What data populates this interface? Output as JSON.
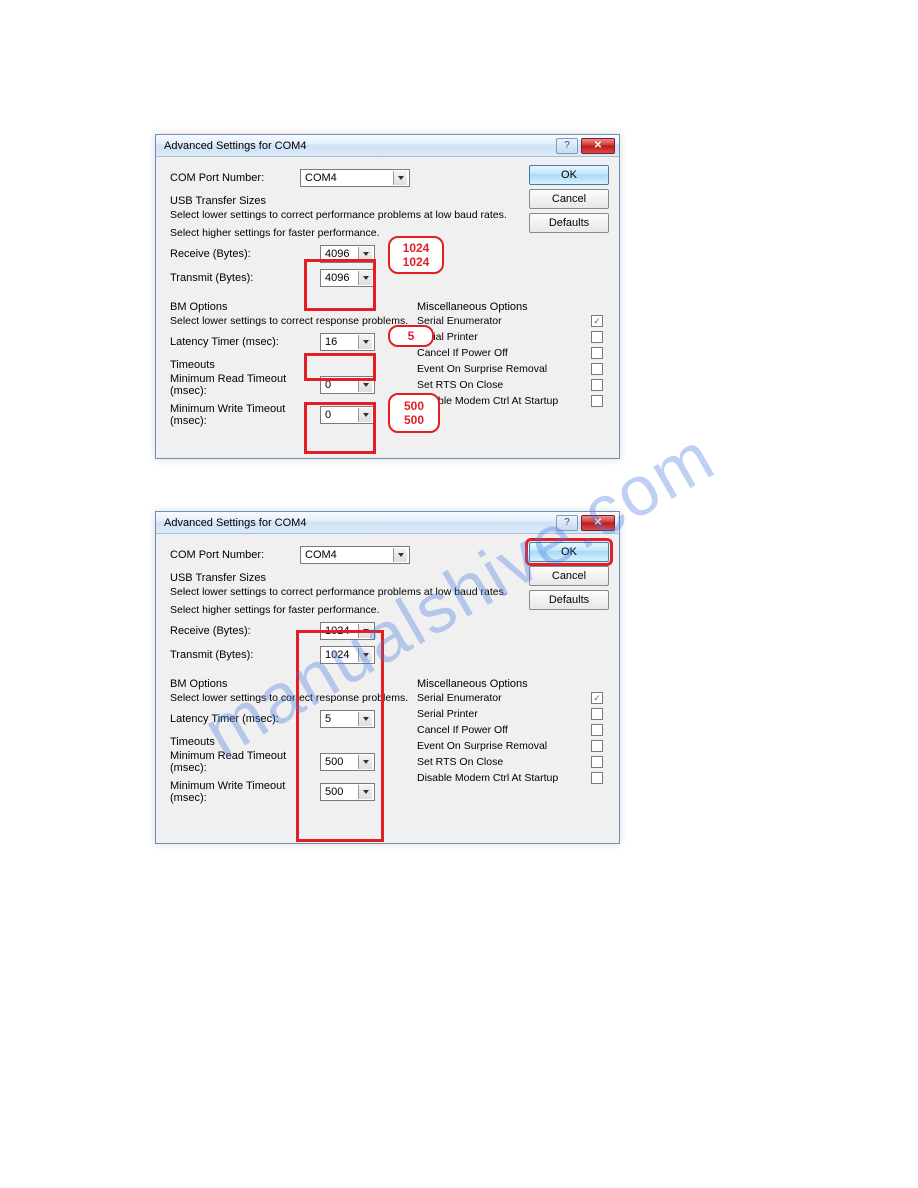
{
  "watermark": "manualshive.com",
  "dialog1": {
    "title": "Advanced Settings for COM4",
    "comport_label": "COM Port Number:",
    "comport_value": "COM4",
    "buttons": {
      "ok": "OK",
      "cancel": "Cancel",
      "defaults": "Defaults"
    },
    "usb_group": "USB Transfer Sizes",
    "usb_help1": "Select lower settings to correct performance problems at low baud rates.",
    "usb_help2": "Select higher settings for faster performance.",
    "receive_label": "Receive (Bytes):",
    "receive_value": "4096",
    "transmit_label": "Transmit (Bytes):",
    "transmit_value": "4096",
    "bm_group": "BM Options",
    "bm_help": "Select lower settings to correct response problems.",
    "latency_label": "Latency Timer (msec):",
    "latency_value": "16",
    "timeouts_group": "Timeouts",
    "min_read_label": "Minimum Read Timeout (msec):",
    "min_read_value": "0",
    "min_write_label": "Minimum Write Timeout (msec):",
    "min_write_value": "0",
    "misc_group": "Miscellaneous Options",
    "misc": {
      "serial_enum": "Serial Enumerator",
      "serial_printer": "Serial Printer",
      "cancel_poweroff": "Cancel If Power Off",
      "event_surprise": "Event On Surprise Removal",
      "set_rts": "Set RTS On Close",
      "disable_modem": "Disable Modem Ctrl At Startup"
    },
    "callouts": {
      "usb1": "1024",
      "usb2": "1024",
      "lat": "5",
      "to1": "500",
      "to2": "500"
    }
  },
  "dialog2": {
    "title": "Advanced Settings for COM4",
    "comport_label": "COM Port Number:",
    "comport_value": "COM4",
    "buttons": {
      "ok": "OK",
      "cancel": "Cancel",
      "defaults": "Defaults"
    },
    "usb_group": "USB Transfer Sizes",
    "usb_help1": "Select lower settings to correct performance problems at low baud rates.",
    "usb_help2": "Select higher settings for faster performance.",
    "receive_label": "Receive (Bytes):",
    "receive_value": "1024",
    "transmit_label": "Transmit (Bytes):",
    "transmit_value": "1024",
    "bm_group": "BM Options",
    "bm_help": "Select lower settings to correct response problems.",
    "latency_label": "Latency Timer (msec):",
    "latency_value": "5",
    "timeouts_group": "Timeouts",
    "min_read_label": "Minimum Read Timeout (msec):",
    "min_read_value": "500",
    "min_write_label": "Minimum Write Timeout (msec):",
    "min_write_value": "500",
    "misc_group": "Miscellaneous Options",
    "misc": {
      "serial_enum": "Serial Enumerator",
      "serial_printer": "Serial Printer",
      "cancel_poweroff": "Cancel If Power Off",
      "event_surprise": "Event On Surprise Removal",
      "set_rts": "Set RTS On Close",
      "disable_modem": "Disable Modem Ctrl At Startup"
    }
  }
}
